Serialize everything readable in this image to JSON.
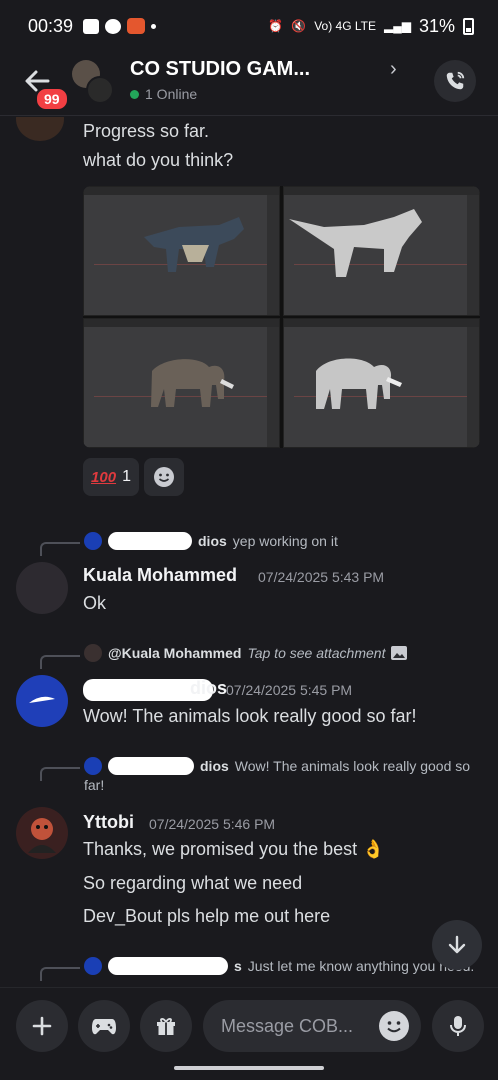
{
  "status_bar": {
    "time": "00:39",
    "network": "Vo) 4G LTE",
    "battery": "31%"
  },
  "header": {
    "unread_badge": "99",
    "title": "CO      STUDIO GAM...",
    "online_status": "1 Online"
  },
  "messages": {
    "intro_line1": "Progress so far.",
    "intro_line2": "what do you think?",
    "reaction": {
      "emoji": "100",
      "count": "1"
    },
    "reply1": {
      "author": "dios",
      "text": "yep working on it"
    },
    "msg1": {
      "author": "Kuala Mohammed",
      "timestamp": "07/24/2025 5:43 PM",
      "text": "Ok"
    },
    "reply2": {
      "author": "@Kuala Mohammed",
      "text": "Tap to see attachment"
    },
    "msg2": {
      "author": "dios",
      "timestamp": "07/24/2025 5:45 PM",
      "text": "Wow! The animals look really good so far!"
    },
    "reply3": {
      "author": "dios",
      "text_line1": "Wow! The animals look really good so",
      "text_line2": "far!"
    },
    "msg3": {
      "author": "Yttobi",
      "timestamp": "07/24/2025 5:46 PM",
      "text1": "Thanks, we promised you the best 👌",
      "text2": "So regarding what we need",
      "text3": "Dev_Bout pls help me out here"
    },
    "reply4": {
      "author": "s",
      "text": "Just let me know anything you need."
    }
  },
  "composer": {
    "placeholder": "Message COB..."
  },
  "colors": {
    "background": "#1a1a1e",
    "badge": "#f23f43",
    "online": "#23a55a",
    "panel": "#2b2c31",
    "reaction_red": "#e03a3e"
  },
  "icons": [
    "back-arrow-icon",
    "phone-call-icon",
    "add-reaction-icon",
    "scroll-down-icon",
    "plus-icon",
    "gamepad-icon",
    "gift-icon",
    "emoji-icon",
    "microphone-icon"
  ]
}
